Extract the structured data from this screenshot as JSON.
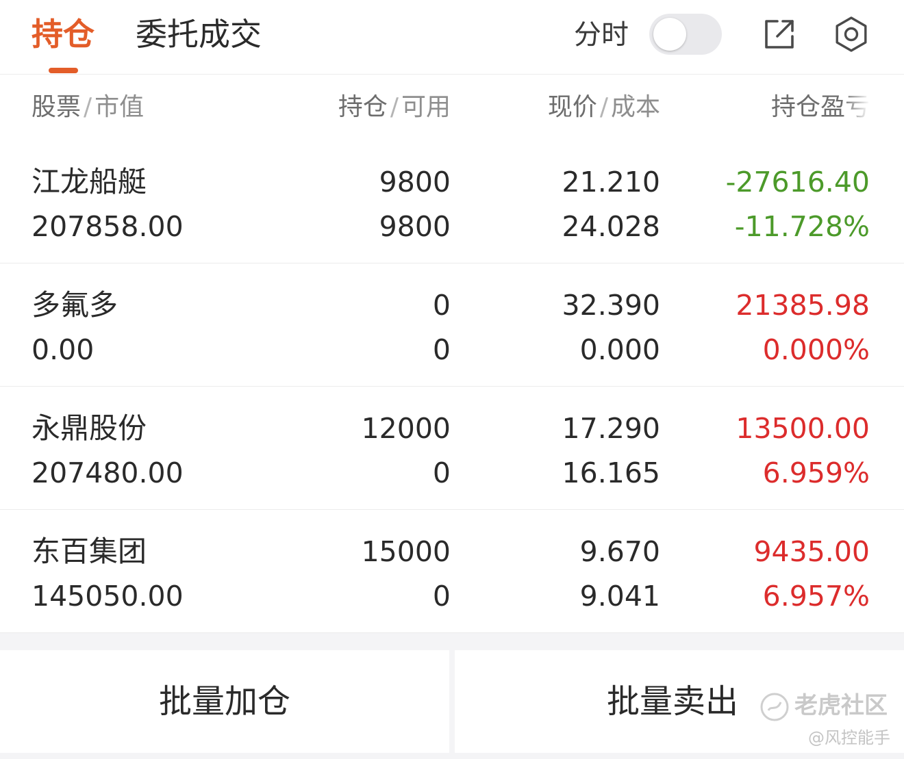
{
  "tabs": {
    "positions": "持仓",
    "orders": "委托成交"
  },
  "header": {
    "intraday_label": "分时",
    "intraday_toggle_on": false
  },
  "icons": {
    "share": "share-icon",
    "settings": "gear-icon"
  },
  "columns": {
    "stock": "股票",
    "market_value": "市值",
    "position": "持仓",
    "available": "可用",
    "price": "现价",
    "cost": "成本",
    "pl": "持仓盈亏",
    "separator": "/"
  },
  "colors": {
    "accent": "#e35d29",
    "loss": "#4c9a2a",
    "gain": "#dc2c2c"
  },
  "holdings": [
    {
      "name": "江龙船艇",
      "market_value": "207858.00",
      "position": "9800",
      "available": "9800",
      "price": "21.210",
      "cost": "24.028",
      "pl": "-27616.40",
      "pl_pct": "-11.728%",
      "trend": "loss"
    },
    {
      "name": "多氟多",
      "market_value": "0.00",
      "position": "0",
      "available": "0",
      "price": "32.390",
      "cost": "0.000",
      "pl": "21385.98",
      "pl_pct": "0.000%",
      "trend": "gain"
    },
    {
      "name": "永鼎股份",
      "market_value": "207480.00",
      "position": "12000",
      "available": "0",
      "price": "17.290",
      "cost": "16.165",
      "pl": "13500.00",
      "pl_pct": "6.959%",
      "trend": "gain"
    },
    {
      "name": "东百集团",
      "market_value": "145050.00",
      "position": "15000",
      "available": "0",
      "price": "9.670",
      "cost": "9.041",
      "pl": "9435.00",
      "pl_pct": "6.957%",
      "trend": "gain"
    }
  ],
  "buttons": {
    "batch_add": "批量加仓",
    "batch_sell": "批量卖出"
  },
  "watermark": {
    "brand": "老虎社区",
    "user": "@风控能手"
  }
}
